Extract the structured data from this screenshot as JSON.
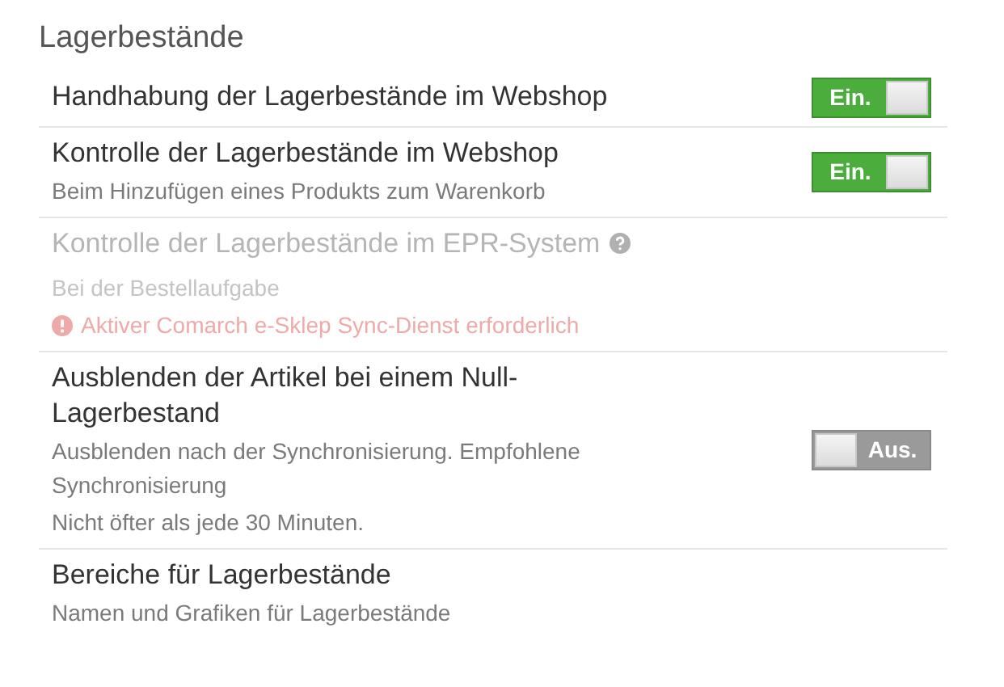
{
  "heading": "Lagerbestände",
  "rows": [
    {
      "title": "Handhabung der Lagerbestände im Webshop",
      "disabled": false,
      "help": false,
      "descriptions": [],
      "toggle": {
        "on": true,
        "label": "Ein."
      }
    },
    {
      "title": "Kontrolle der Lagerbestände im Webshop",
      "disabled": false,
      "help": false,
      "descriptions": [
        "Beim Hinzufügen eines Produkts zum Warenkorb"
      ],
      "toggle": {
        "on": true,
        "label": "Ein."
      }
    },
    {
      "title": "Kontrolle der Lagerbestände im EPR-System",
      "disabled": true,
      "help": true,
      "descriptions": [
        "Bei der Bestellaufgabe"
      ],
      "warning": "Aktiver Comarch e-Sklep Sync-Dienst erforderlich"
    },
    {
      "title": "Ausblenden der Artikel bei einem Null-Lagerbestand",
      "disabled": false,
      "help": false,
      "descriptions": [
        "Ausblenden nach der Synchronisierung. Empfohlene Synchronisierung",
        "Nicht öfter als jede 30 Minuten."
      ],
      "toggle": {
        "on": false,
        "label": "Aus."
      }
    },
    {
      "title": "Bereiche für Lagerbestände",
      "disabled": false,
      "help": false,
      "descriptions": [
        "Namen und Grafiken für Lagerbestände"
      ]
    }
  ]
}
